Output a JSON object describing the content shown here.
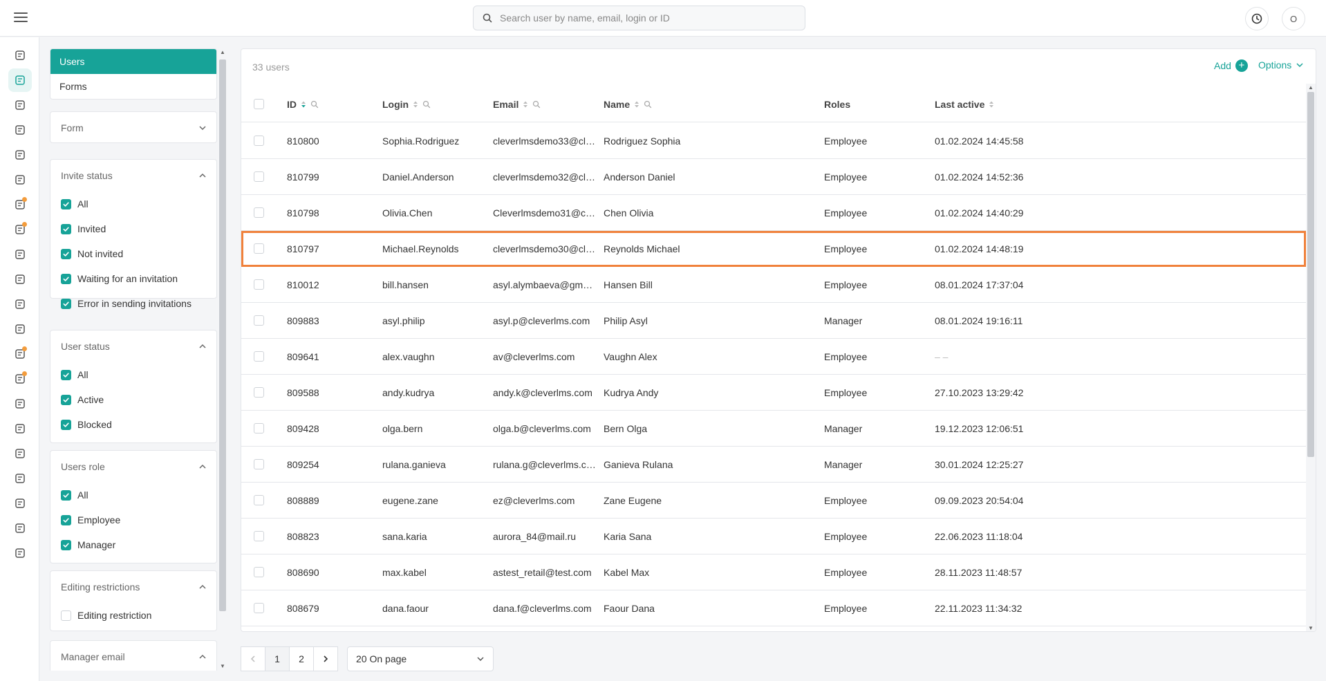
{
  "search": {
    "placeholder": "Search user by name, email, login or ID"
  },
  "header": {
    "avatar_initial": "O"
  },
  "colors": {
    "accent": "#17a398",
    "highlight": "#f0813b"
  },
  "rail_icons": [
    "courses-icon",
    "users-icon",
    "settings-icon",
    "analytics-icon",
    "tests-icon",
    "documents-icon",
    "skills-icon",
    "tasks-icon",
    "library-icon",
    "support-icon",
    "events-icon",
    "info-icon",
    "chat-icon",
    "video-icon",
    "trophy-icon",
    "gift-icon",
    "user-check-icon",
    "trend-icon",
    "star-icon",
    "monitor-icon",
    "external-link-icon"
  ],
  "sidebar": {
    "tabs": [
      {
        "label": "Users"
      },
      {
        "label": "Forms"
      }
    ],
    "form_filter": {
      "title": "Form"
    },
    "invite_status": {
      "title": "Invite status",
      "options": [
        "All",
        "Invited",
        "Not invited",
        "Waiting for an invitation",
        "Error in sending invitations"
      ]
    },
    "user_status": {
      "title": "User status",
      "options": [
        "All",
        "Active",
        "Blocked"
      ]
    },
    "users_role": {
      "title": "Users role",
      "options": [
        "All",
        "Employee",
        "Manager"
      ]
    },
    "editing_restrictions": {
      "title": "Editing restrictions",
      "options": [
        "Editing restriction"
      ]
    },
    "manager_email": {
      "title": "Manager email"
    }
  },
  "main": {
    "count": "33 users",
    "add_label": "Add",
    "options_label": "Options",
    "columns": [
      "ID",
      "Login",
      "Email",
      "Name",
      "Roles",
      "Last active"
    ],
    "rows": [
      [
        "810800",
        "Sophia.Rodriguez",
        "cleverlmsdemo33@clev...",
        "Rodriguez Sophia",
        "Employee",
        "01.02.2024 14:45:58"
      ],
      [
        "810799",
        "Daniel.Anderson",
        "cleverlmsdemo32@clev...",
        "Anderson Daniel",
        "Employee",
        "01.02.2024 14:52:36"
      ],
      [
        "810798",
        "Olivia.Chen",
        "Cleverlmsdemo31@clev...",
        "Chen Olivia",
        "Employee",
        "01.02.2024 14:40:29"
      ],
      [
        "810797",
        "Michael.Reynolds",
        "cleverlmsdemo30@clev...",
        "Reynolds Michael",
        "Employee",
        "01.02.2024 14:48:19"
      ],
      [
        "810012",
        "bill.hansen",
        "asyl.alymbaeva@gmail.c...",
        "Hansen Bill",
        "Employee",
        "08.01.2024 17:37:04"
      ],
      [
        "809883",
        "asyl.philip",
        "asyl.p@cleverlms.com",
        "Philip Asyl",
        "Manager",
        "08.01.2024 19:16:11"
      ],
      [
        "809641",
        "alex.vaughn",
        "av@cleverlms.com",
        "Vaughn Alex",
        "Employee",
        "– –"
      ],
      [
        "809588",
        "andy.kudrya",
        "andy.k@cleverlms.com",
        "Kudrya Andy",
        "Employee",
        "27.10.2023 13:29:42"
      ],
      [
        "809428",
        "olga.bern",
        "olga.b@cleverlms.com",
        "Bern Olga",
        "Manager",
        "19.12.2023 12:06:51"
      ],
      [
        "809254",
        "rulana.ganieva",
        "rulana.g@cleverlms.com",
        "Ganieva Rulana",
        "Manager",
        "30.01.2024 12:25:27"
      ],
      [
        "808889",
        "eugene.zane",
        "ez@cleverlms.com",
        "Zane Eugene",
        "Employee",
        "09.09.2023 20:54:04"
      ],
      [
        "808823",
        "sana.karia",
        "aurora_84@mail.ru",
        "Karia Sana",
        "Employee",
        "22.06.2023 11:18:04"
      ],
      [
        "808690",
        "max.kabel",
        "astest_retail@test.com",
        "Kabel Max",
        "Employee",
        "28.11.2023 11:48:57"
      ],
      [
        "808679",
        "dana.faour",
        "dana.f@cleverlms.com",
        "Faour Dana",
        "Employee",
        "22.11.2023 11:34:32"
      ]
    ]
  },
  "pagination": {
    "pages": [
      "1",
      "2"
    ],
    "per_page": "20 On page"
  }
}
